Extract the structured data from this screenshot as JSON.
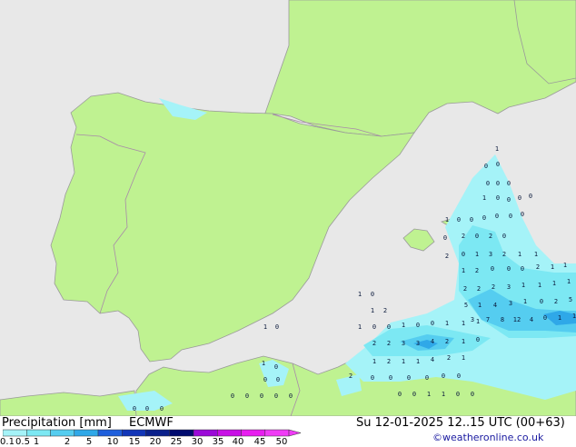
{
  "title": "Precipitation [mm]",
  "model": "ECMWF",
  "valid": "Su 12-01-2025 12..15 UTC (00+63)",
  "credit": "©weatheronline.co.uk",
  "colors": {
    "sea": "#e8e8e8",
    "land": "#bff291",
    "coast": "#9a9a9a",
    "border": "#a88aa8",
    "precip": [
      "#a5f3f8",
      "#7ce8f3",
      "#55cdf0",
      "#2fa8e8",
      "#1f5fdc",
      "#1236b8",
      "#0b218c",
      "#000b6f",
      "#9b0ad8",
      "#c810e6",
      "#e81ef0",
      "#f03cf6"
    ]
  },
  "scale_labels": [
    "0.1",
    "0.5",
    "1",
    "2",
    "5",
    "10",
    "15",
    "20",
    "25",
    "30",
    "35",
    "40",
    "45",
    "50"
  ],
  "point_values": [
    "1",
    "0",
    "0",
    "0",
    "0",
    "0",
    "1",
    "0",
    "0",
    "0",
    "0",
    "1",
    "0",
    "0",
    "0",
    "0",
    "0",
    "0",
    "0",
    "2",
    "0",
    "2",
    "0",
    "2",
    "0",
    "1",
    "3",
    "2",
    "1",
    "1",
    "1",
    "2",
    "0",
    "0",
    "0",
    "2",
    "1",
    "1",
    "2",
    "2",
    "2",
    "3",
    "1",
    "1",
    "1",
    "1",
    "5",
    "1",
    "4",
    "3",
    "1",
    "0",
    "2",
    "5",
    "3",
    "7",
    "8",
    "12",
    "4",
    "0",
    "1",
    "1",
    "1",
    "0",
    "1",
    "2",
    "1",
    "0",
    "0",
    "1",
    "0",
    "0",
    "1",
    "1",
    "1",
    "2",
    "2",
    "3",
    "3",
    "4",
    "2",
    "1",
    "0",
    "1",
    "2",
    "1",
    "1",
    "4",
    "2",
    "1",
    "1",
    "0",
    "1",
    "0",
    "0",
    "0",
    "2",
    "0",
    "0",
    "0",
    "0",
    "0",
    "0",
    "0",
    "0",
    "1",
    "1",
    "0",
    "0",
    "0",
    "0",
    "0",
    "0",
    "0",
    "0",
    "0",
    "0"
  ]
}
